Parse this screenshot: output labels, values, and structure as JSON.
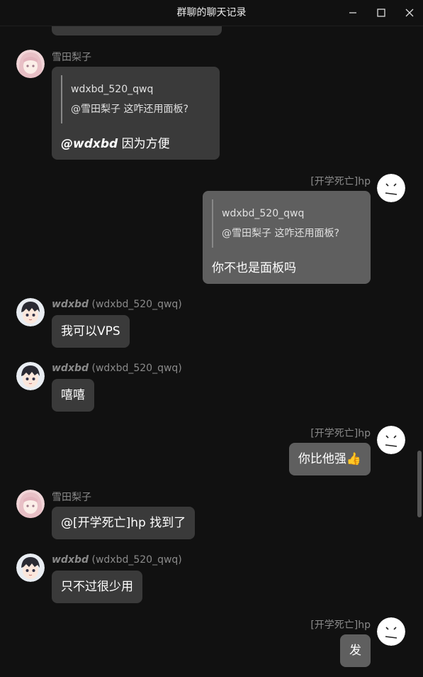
{
  "window": {
    "title": "群聊的聊天记录",
    "minimize_glyph": "—",
    "maximize_glyph": "☐",
    "close_glyph": "✕"
  },
  "colors": {
    "background": "#111111",
    "bubble_left": "#3a3a3a",
    "bubble_right": "#5f5f5f",
    "sender_text": "#8a8a8a"
  },
  "messages": [
    {
      "sender": "雪田梨子",
      "side": "left",
      "avatar": "anime-girl-avatar",
      "quote_author": "wdxbd_520_qwq",
      "quote_text": "@雪田梨子 这咋还用面板?",
      "mention": "@wdxbd",
      "text": " 因为方便"
    },
    {
      "sender": "[开学死亡]hp",
      "side": "right",
      "avatar": "neutral-face-avatar",
      "quote_author": "wdxbd_520_qwq",
      "quote_text": "@雪田梨子 这咋还用面板?",
      "text": "你不也是面板吗"
    },
    {
      "sender_nick": "wdxbd",
      "sender_id": "(wdxbd_520_qwq)",
      "side": "left",
      "avatar": "anime-boy-avatar",
      "text": "我可以VPS"
    },
    {
      "sender_nick": "wdxbd",
      "sender_id": "(wdxbd_520_qwq)",
      "side": "left",
      "avatar": "anime-boy-avatar",
      "text": "嘻嘻"
    },
    {
      "sender": "[开学死亡]hp",
      "side": "right",
      "avatar": "neutral-face-avatar",
      "text": "你比他强",
      "emoji": "👍"
    },
    {
      "sender": "雪田梨子",
      "side": "left",
      "avatar": "anime-girl-avatar",
      "text": "@[开学死亡]hp 找到了"
    },
    {
      "sender_nick": "wdxbd",
      "sender_id": "(wdxbd_520_qwq)",
      "side": "left",
      "avatar": "anime-boy-avatar",
      "text": "只不过很少用"
    },
    {
      "sender": "[开学死亡]hp",
      "side": "right",
      "avatar": "neutral-face-avatar",
      "text": "发"
    }
  ]
}
